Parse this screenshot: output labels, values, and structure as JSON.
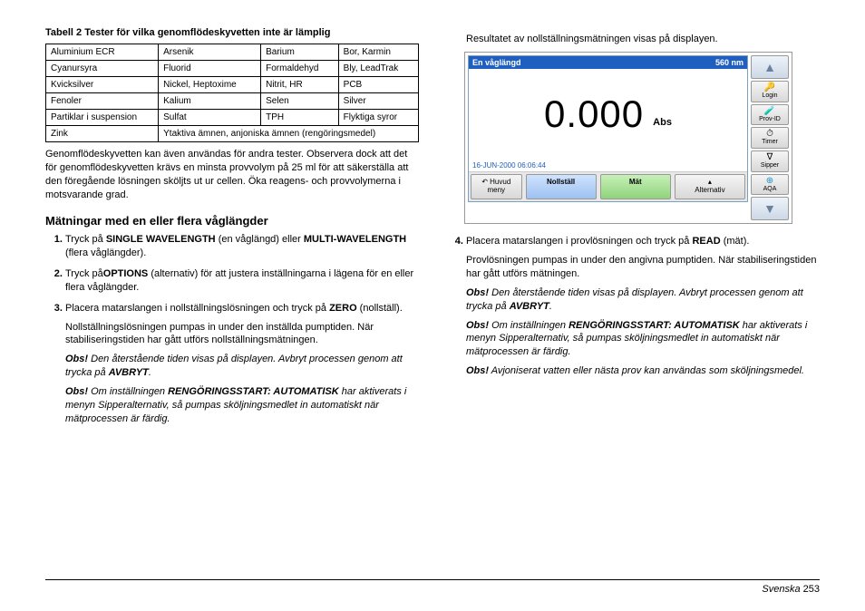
{
  "left": {
    "table_caption": "Tabell 2 Tester för vilka genomflödeskyvetten inte är lämplig",
    "table_rows": [
      [
        "Aluminium ECR",
        "Arsenik",
        "Barium",
        "Bor, Karmin"
      ],
      [
        "Cyanursyra",
        "Fluorid",
        "Formaldehyd",
        "Bly, LeadTrak"
      ],
      [
        "Kvicksilver",
        "Nickel, Heptoxime",
        "Nitrit, HR",
        "PCB"
      ],
      [
        "Fenoler",
        "Kalium",
        "Selen",
        "Silver"
      ],
      [
        "Partiklar i suspension",
        "Sulfat",
        "TPH",
        "Flyktiga syror"
      ]
    ],
    "zink_label": "Zink",
    "zink_span": "Ytaktiva ämnen, anjoniska ämnen (rengöringsmedel)",
    "after_table": "Genomflödeskyvetten kan även användas för andra tester. Observera dock att det för genomflödeskyvetten krävs en minsta provvolym på 25 ml för att säkerställa att den föregående lösningen sköljts ut ur cellen. Öka reagens- och provvolymerna i motsvarande grad.",
    "h3": "Mätningar med en eller flera våglängder",
    "step1_a": "Tryck på ",
    "step1_b1": "SINGLE WAVELENGTH",
    "step1_c": " (en våglängd) eller ",
    "step1_b2": "MULTI-WAVELENGTH",
    "step1_d": " (flera våglängder).",
    "step2_a": "Tryck på",
    "step2_b": "OPTIONS",
    "step2_c": " (alternativ) för att justera inställningarna i lägena för en eller flera våglängder.",
    "step3_a": "Placera matarslangen i nollställningslösningen och tryck på ",
    "step3_b": "ZERO",
    "step3_c": " (nollställ).",
    "step3_sub": "Nollställningslösningen pumpas in under den inställda pumptiden. När stabiliseringstiden har gått utförs nollställningsmätningen.",
    "note1_a": "Obs!",
    "note1_b": " Den återstående tiden visas på displayen. Avbryt processen genom att trycka på ",
    "note1_c": "AVBRYT",
    "note1_d": ".",
    "note2_a": "Obs!",
    "note2_b": " Om inställningen ",
    "note2_c": "RENGÖRINGSSTART: AUTOMATISK",
    "note2_d": "  har aktiverats i menyn Sipperalternativ, så pumpas sköljningsmedlet in automatiskt när mätprocessen är färdig."
  },
  "right": {
    "intro": "Resultatet av nollställningsmätningen visas på displayen.",
    "device": {
      "title": "En våglängd",
      "wavelength": "560 nm",
      "reading": "0.000",
      "unit": "Abs",
      "timestamp": "16-JUN-2000  06:06:44",
      "btn_back_line1": "Huvud",
      "btn_back_line2": "meny",
      "btn_zero": "Nollställ",
      "btn_meas": "Mät",
      "btn_options": "Alternativ",
      "side": {
        "login": "Login",
        "provid": "Prov-ID",
        "timer": "Timer",
        "sipper": "Sipper",
        "aqa": "AQA"
      }
    },
    "step4_a": "Placera matarslangen i provlösningen och tryck på ",
    "step4_b": "READ",
    "step4_c": " (mät).",
    "step4_sub": "Provlösningen pumpas in under den angivna pumptiden. När stabiliseringstiden har gått utförs mätningen.",
    "rnote1_a": "Obs!",
    "rnote1_b": " Den återstående tiden visas på displayen. Avbryt processen genom att trycka på ",
    "rnote1_c": "AVBRYT",
    "rnote1_d": ".",
    "rnote2_a": "Obs!",
    "rnote2_b": " Om inställningen ",
    "rnote2_c": "RENGÖRINGSSTART: AUTOMATISK",
    "rnote2_d": "  har aktiverats i menyn Sipperalternativ, så pumpas sköljningsmedlet in automatiskt när mätprocessen är färdig.",
    "rnote3_a": "Obs!",
    "rnote3_b": " Avjoniserat vatten eller nästa prov kan användas som sköljningsmedel."
  },
  "footer": {
    "lang": "Svenska",
    "page": " 253"
  }
}
